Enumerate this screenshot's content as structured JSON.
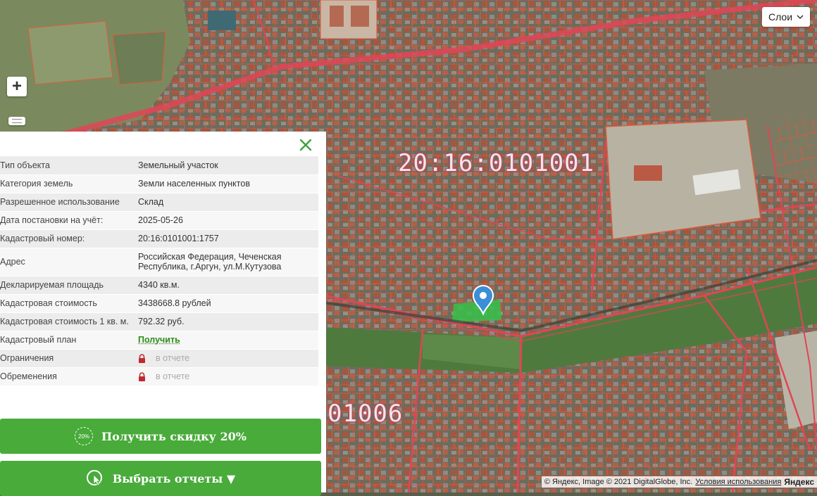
{
  "map": {
    "layers_label": "Слои",
    "cadastral_quarter_main": "20:16:0101001",
    "cadastral_quarter_secondary": "01006",
    "copyright": "© Яндекс, Image © 2021 DigitalGlobe, Inc.",
    "terms_label": "Условия использования",
    "yandex_logo": "Яндекс"
  },
  "colors": {
    "accent_green": "#48ab3a",
    "link_green": "#2c8b1b",
    "parcel_line": "#e05a3a",
    "road_line": "#e04556",
    "marker": "#3a8fd6"
  },
  "icons": {
    "close": "close-icon",
    "lock": "lock-icon",
    "discount": "discount-badge-icon",
    "reports": "pointer-icon",
    "chevron": "chevron-down-icon"
  },
  "info": {
    "rows": [
      {
        "key": "Тип объекта",
        "value": "Земельный участок"
      },
      {
        "key": "Категория земель",
        "value": "Земли населенных пунктов"
      },
      {
        "key": "Разрешенное использование",
        "value": "Склад"
      },
      {
        "key": "Дата постановки на учёт:",
        "value": "2025-05-26"
      },
      {
        "key": "Кадастровый номер:",
        "value": "20:16:0101001:1757"
      },
      {
        "key": "Адрес",
        "value_line1": "Российская Федерация, Чеченская",
        "value_line2": "Республика, г.Аргун, ул.М.Кутузова"
      },
      {
        "key": "Декларируемая площадь",
        "value": "4340 кв.м."
      },
      {
        "key": "Кадастровая стоимость",
        "value": "3438668.8 рублей"
      },
      {
        "key": "Кадастровая стоимость 1 кв. м.",
        "value": "792.32 руб."
      },
      {
        "key": "Кадастровый план",
        "value": "Получить"
      },
      {
        "key": "Ограничения",
        "value": "в отчете"
      },
      {
        "key": "Обременения",
        "value": "в отчете"
      }
    ]
  },
  "actions": {
    "discount_badge": "20%",
    "discount_label": "Получить скидку 20%",
    "reports_label": "Выбрать отчеты ▼"
  }
}
